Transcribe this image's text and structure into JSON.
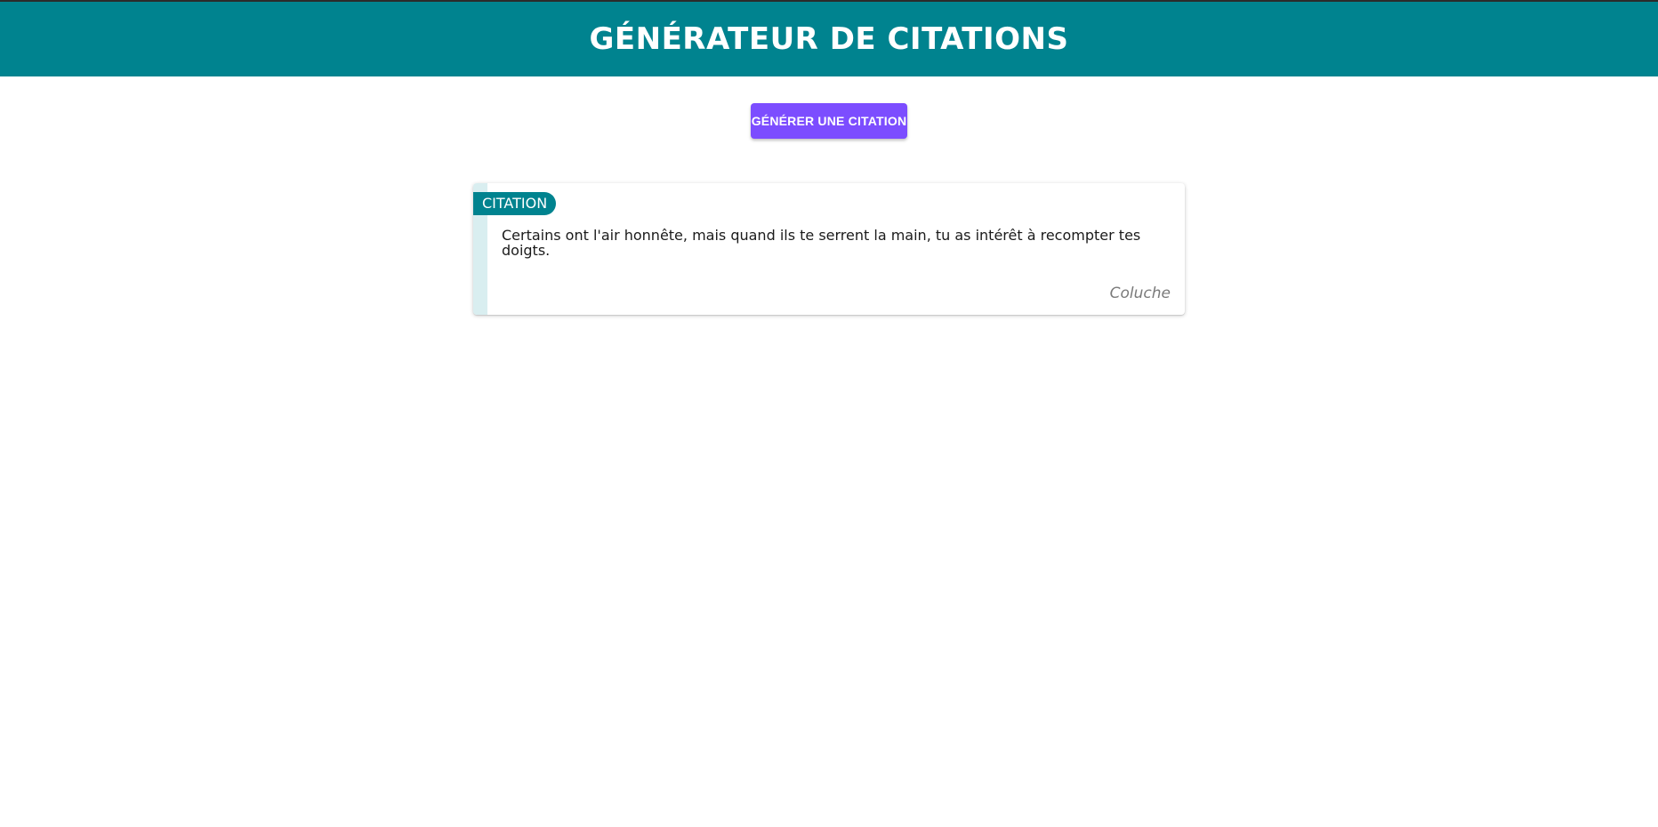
{
  "header": {
    "title": "GÉNÉRATEUR DE CITATIONS"
  },
  "actions": {
    "generate_label": "GÉNÉRER UNE CITATION"
  },
  "quote": {
    "badge": "CITATION",
    "text": "Certains ont l'air honnête, mais quand ils te serrent la main, tu as intérêt à recompter tes doigts.",
    "author": "Coluche"
  },
  "colors": {
    "header_background": "#00838f",
    "button_background": "#7c4dff",
    "badge_background": "#00838f",
    "card_stripe": "#d9eef0"
  }
}
